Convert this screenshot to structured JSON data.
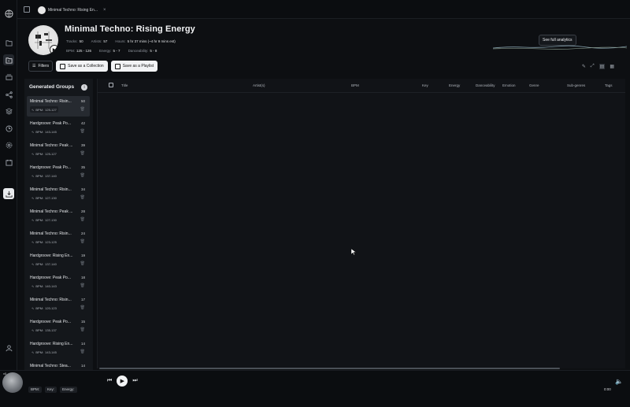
{
  "tab": {
    "title": "Minimal Techno: Rising En..."
  },
  "playlist": {
    "title": "Minimal Techno: Rising Energy",
    "stats": {
      "tracks_label": "Tracks:",
      "tracks": "50",
      "artists_label": "Artists:",
      "artists": "57",
      "hours_label": "Hours:",
      "hours": "5 hr 37 mins (~4 hr 9 mins est)",
      "bpm_label": "BPM:",
      "bpm": "125 - 126",
      "energy_label": "Energy:",
      "energy": "5 - 7",
      "dance_label": "Danceability:",
      "dance": "5 - 8"
    },
    "analytics_button": "See full analytics"
  },
  "actions": {
    "filters": "Filters",
    "save_collection": "Save as a Collection",
    "save_playlist": "Save as a Playlist"
  },
  "groups": {
    "heading": "Generated Groups",
    "bpm_label": "BPM:",
    "items": [
      {
        "name": "Minimal Techno: Risin...",
        "count": "50",
        "bpm": "125-127"
      },
      {
        "name": "Hardgroove: Peak Po...",
        "count": "42",
        "bpm": "143-145"
      },
      {
        "name": "Minimal Techno: Peak ...",
        "count": "39",
        "bpm": "125-127"
      },
      {
        "name": "Hardgroove: Peak Po...",
        "count": "35",
        "bpm": "137-140"
      },
      {
        "name": "Minimal Techno: Risin...",
        "count": "34",
        "bpm": "127-130"
      },
      {
        "name": "Minimal Techno: Peak ...",
        "count": "28",
        "bpm": "127-130"
      },
      {
        "name": "Minimal Techno: Risin...",
        "count": "24",
        "bpm": "123-125"
      },
      {
        "name": "Hardgroove: Rising En...",
        "count": "19",
        "bpm": "137-140"
      },
      {
        "name": "Hardgroove: Peak Po...",
        "count": "18",
        "bpm": "140-143"
      },
      {
        "name": "Minimal Techno: Risin...",
        "count": "17",
        "bpm": "120-123"
      },
      {
        "name": "Hardgroove: Peak Po...",
        "count": "15",
        "bpm": "135-137"
      },
      {
        "name": "Hardgroove: Rising En...",
        "count": "14",
        "bpm": "143-145"
      },
      {
        "name": "Minimal Techno: Stea...",
        "count": "14",
        "bpm": ""
      }
    ]
  },
  "table": {
    "columns": [
      "Title",
      "Artist(s)",
      "BPM",
      "Key",
      "Energy",
      "Danceability",
      "Emotion",
      "Genre",
      "Sub-genres",
      "Tags"
    ]
  },
  "player": {
    "version": "v0",
    "chips": [
      "BPM:",
      "Key:",
      "Energy:"
    ],
    "time": "0:00"
  },
  "colors": {
    "background": "#0d0f12",
    "panel": "#14171b",
    "accent": "#f2f3f5"
  }
}
